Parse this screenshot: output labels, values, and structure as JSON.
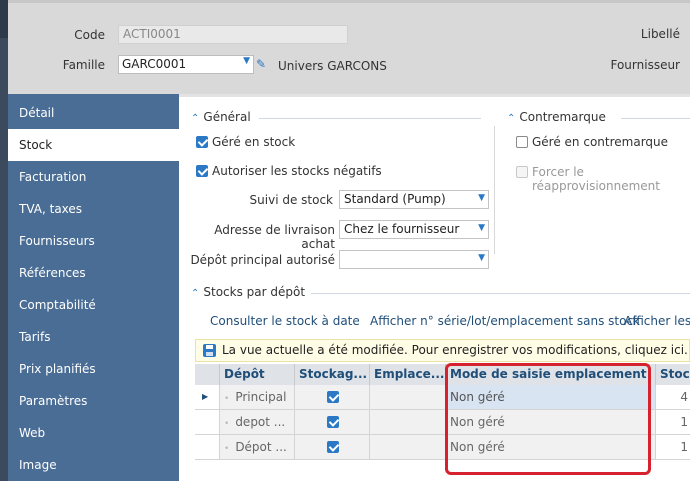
{
  "header": {
    "code_label": "Code",
    "code_value": "ACTI0001",
    "famille_label": "Famille",
    "famille_value": "GARC0001",
    "famille_desc": "Univers GARCONS",
    "libelle_label": "Libellé",
    "fournisseur_label": "Fournisseur"
  },
  "sidebar": {
    "items": [
      {
        "label": "Détail"
      },
      {
        "label": "Stock"
      },
      {
        "label": "Facturation"
      },
      {
        "label": "TVA, taxes"
      },
      {
        "label": "Fournisseurs"
      },
      {
        "label": "Références"
      },
      {
        "label": "Comptabilité"
      },
      {
        "label": "Tarifs"
      },
      {
        "label": "Prix planifiés"
      },
      {
        "label": "Paramètres"
      },
      {
        "label": "Web"
      },
      {
        "label": "Image"
      }
    ],
    "active_index": 1
  },
  "general": {
    "title": "Général",
    "gere_en_stock": "Géré en stock",
    "autoriser_negatifs": "Autoriser les stocks négatifs",
    "suivi_label": "Suivi de stock",
    "suivi_value": "Standard (Pump)",
    "adresse_label": "Adresse de livraison achat",
    "adresse_value": "Chez le fournisseur",
    "depot_label": "Dépôt principal autorisé",
    "depot_value": ""
  },
  "contremarque": {
    "title": "Contremarque",
    "gere_contremarque": "Géré en contremarque",
    "forcer": "Forcer le réapprovisionnement"
  },
  "stocks_depot": {
    "title": "Stocks par dépôt",
    "links": [
      "Consulter le stock à date",
      "Afficher n° série/lot/emplacement sans stock",
      "Afficher les e"
    ],
    "notice": "La vue actuelle a été modifiée. Pour enregistrer vos modifications, cliquez ici.",
    "columns": [
      "Dépôt",
      "Stockag...",
      "Emplace...",
      "Mode de saisie emplacement",
      "Stoc"
    ],
    "rows": [
      {
        "depot": "Principal",
        "stockage": true,
        "emplacement": "",
        "mode": "Non géré",
        "stock": "4"
      },
      {
        "depot": "depot ...",
        "stockage": true,
        "emplacement": "",
        "mode": "Non géré",
        "stock": "1"
      },
      {
        "depot": "Dépot ...",
        "stockage": true,
        "emplacement": "",
        "mode": "Non géré",
        "stock": "1"
      }
    ]
  },
  "colors": {
    "sidebar_bg": "#4a6d95",
    "accent": "#2b78c5",
    "highlight_box": "#d6222e"
  }
}
